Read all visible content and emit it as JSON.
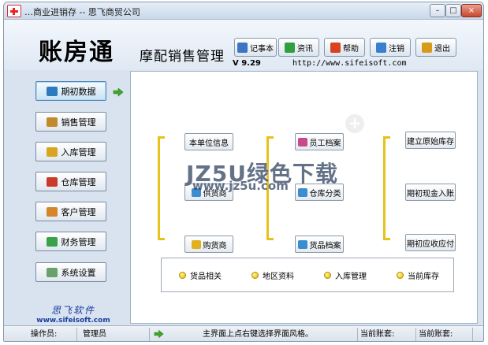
{
  "window": {
    "title": "…商业进销存 -- 思飞商贸公司",
    "minimize_glyph": "–",
    "maximize_glyph": "□",
    "close_glyph": "×"
  },
  "header": {
    "logo": "账房通",
    "module_title": "摩配销售管理",
    "version": "V 9.29",
    "website": "http://www.sifeisoft.com"
  },
  "toolbar": [
    {
      "label": "记事本",
      "icon": "notepad-icon",
      "color": "#3a76c4"
    },
    {
      "label": "资讯",
      "icon": "info-icon",
      "color": "#2f9f3f"
    },
    {
      "label": "帮助",
      "icon": "help-icon",
      "color": "#d8421f"
    },
    {
      "label": "注销",
      "icon": "logout-icon",
      "color": "#3a7ed0"
    },
    {
      "label": "退出",
      "icon": "exit-icon",
      "color": "#d89a1d"
    }
  ],
  "sidebar": {
    "items": [
      {
        "label": "期初数据",
        "icon": "book-icon",
        "color": "#2d7bbf"
      },
      {
        "label": "销售管理",
        "icon": "sales-icon",
        "color": "#c28a2a"
      },
      {
        "label": "入库管理",
        "icon": "box-icon",
        "color": "#d9a520"
      },
      {
        "label": "仓库管理",
        "icon": "warehouse-icon",
        "color": "#c83b2c"
      },
      {
        "label": "客户管理",
        "icon": "customer-icon",
        "color": "#d6862a"
      },
      {
        "label": "财务管理",
        "icon": "finance-icon",
        "color": "#3aa24a"
      },
      {
        "label": "系统设置",
        "icon": "settings-icon",
        "color": "#6aa06a"
      }
    ],
    "active_index": 0,
    "brand_cn": "思飞软件",
    "brand_site": "www.sifeisoft.com"
  },
  "functions": {
    "col1": [
      {
        "label": "本单位信息",
        "icon": "",
        "color": ""
      },
      {
        "label": "供货商",
        "icon": "supplier-icon",
        "color": "#3c8ccf"
      },
      {
        "label": "购货商",
        "icon": "buyer-icon",
        "color": "#e0b020"
      }
    ],
    "col2": [
      {
        "label": "员工档案",
        "icon": "staff-icon",
        "color": "#c94a8a"
      },
      {
        "label": "仓库分类",
        "icon": "category-icon",
        "color": "#3c8ccf"
      },
      {
        "label": "货品档案",
        "icon": "goods-icon",
        "color": "#3c8ccf"
      }
    ],
    "col3": [
      {
        "label": "建立原始库存"
      },
      {
        "label": "期初现金入账"
      },
      {
        "label": "期初应收应付"
      }
    ]
  },
  "quick_links": [
    "货品相关",
    "地区资料",
    "入库管理",
    "当前库存"
  ],
  "overlay": {
    "watermark": "JZ5U绿色下载",
    "watermark_url": "www.jz5u.com"
  },
  "status": {
    "operator_label": "操作员:",
    "operator_value": "管理员",
    "hint": "主界面上点右键选择界面风格。",
    "field3": "当前账套:",
    "field4": "当前账套:"
  },
  "colors": {
    "bracket": "#e7c21b",
    "accent": "#4c87b9",
    "arrow": "#3fa62c"
  }
}
